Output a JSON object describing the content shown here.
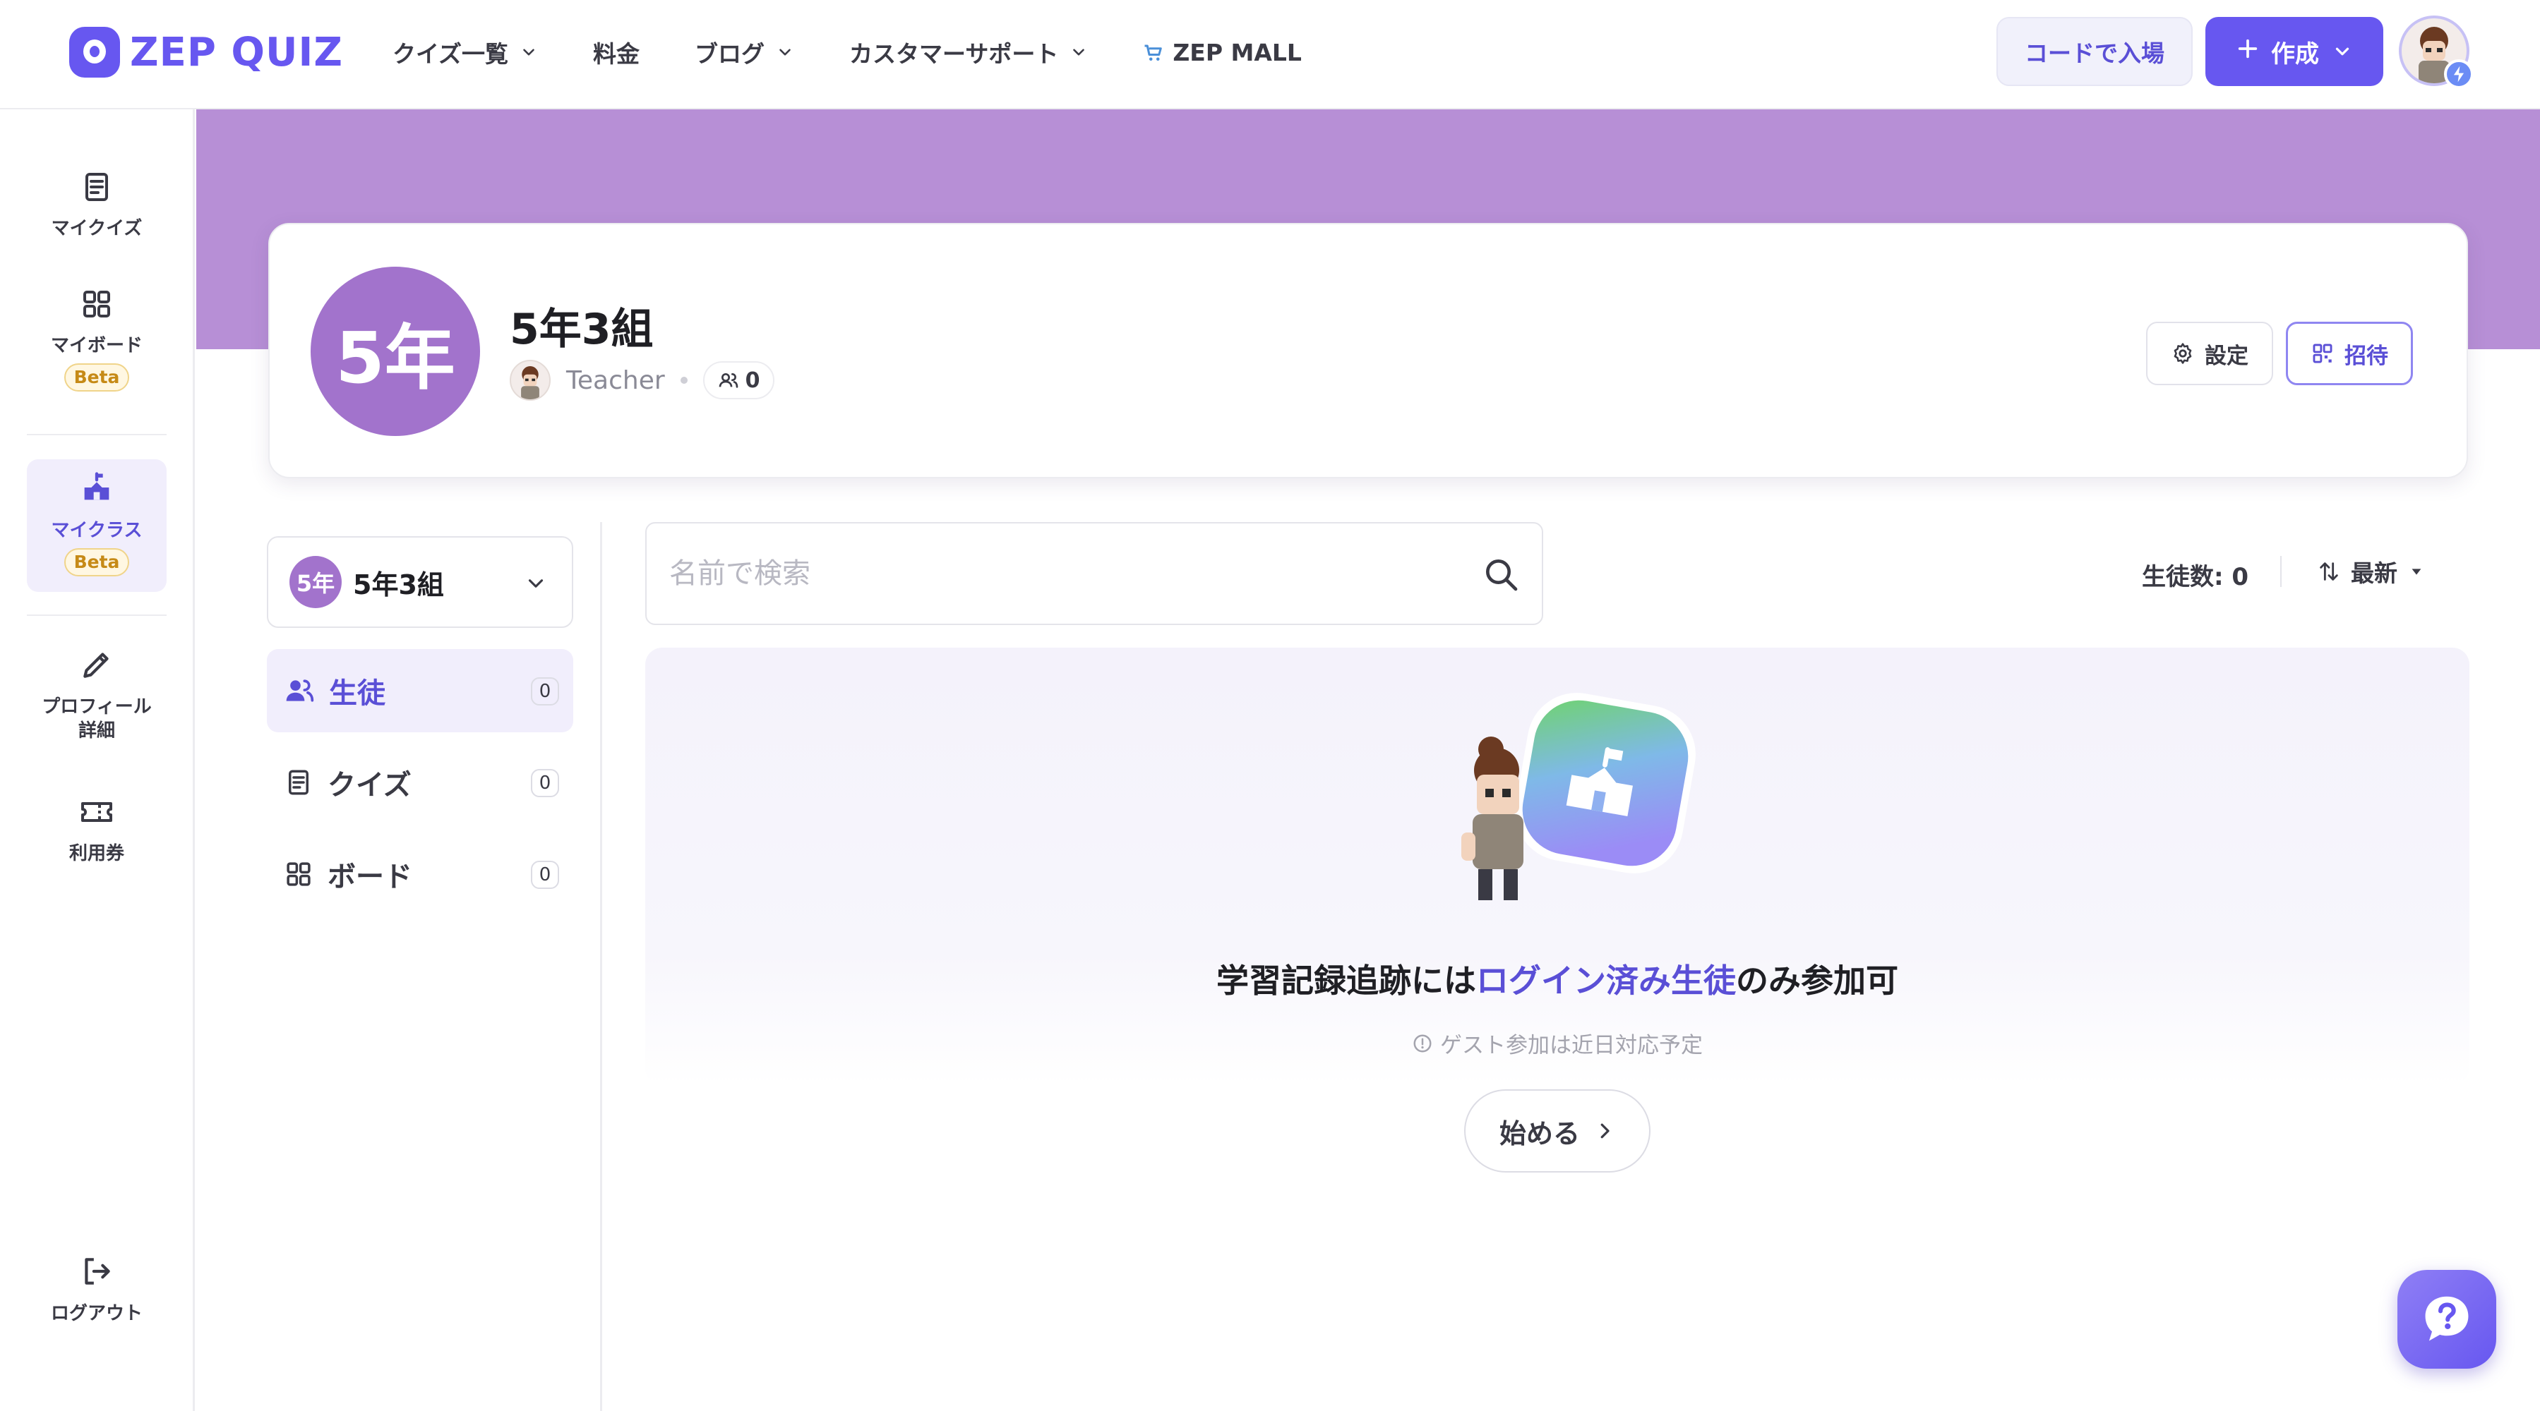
{
  "brand": {
    "name": "ZEP QUIZ",
    "accent": "#6757f0"
  },
  "topnav": {
    "items": [
      {
        "label": "クイズ一覧",
        "has_dropdown": true
      },
      {
        "label": "料金",
        "has_dropdown": false
      },
      {
        "label": "ブログ",
        "has_dropdown": true
      },
      {
        "label": "カスタマーサポート",
        "has_dropdown": true
      },
      {
        "label": "ZEP MALL",
        "has_dropdown": false,
        "icon": "cart-icon"
      }
    ],
    "code_entry_label": "コードで入場",
    "create_label": "作成"
  },
  "sidebar": {
    "items": [
      {
        "label": "マイクイズ",
        "icon": "quiz-book-icon"
      },
      {
        "label": "マイボード",
        "icon": "board-grid-icon",
        "badge": "Beta"
      },
      {
        "label": "マイクラス",
        "icon": "class-icon",
        "badge": "Beta",
        "active": true
      },
      {
        "label": "プロフィール\n詳細",
        "icon": "pencil-icon"
      },
      {
        "label": "利用券",
        "icon": "ticket-icon"
      }
    ],
    "logout_label": "ログアウト"
  },
  "class_card": {
    "badge": "5年",
    "name": "5年3組",
    "teacher": "Teacher",
    "member_count": "0",
    "settings_label": "設定",
    "invite_label": "招待",
    "banner_color": "#b78fd6"
  },
  "class_menu": {
    "selector_badge": "5年",
    "selector_name": "5年3組",
    "items": [
      {
        "label": "生徒",
        "count": "0",
        "active": true
      },
      {
        "label": "クイズ",
        "count": "0"
      },
      {
        "label": "ボード",
        "count": "0"
      }
    ]
  },
  "main": {
    "search_placeholder": "名前で検索",
    "student_count_label": "生徒数: 0",
    "sort_label": "最新",
    "empty": {
      "title_prefix": "学習記録追跡には",
      "title_highlight": "ログイン済み生徒",
      "title_suffix": "のみ参加可",
      "note": "ゲスト参加は近日対応予定",
      "start_label": "始める"
    }
  }
}
